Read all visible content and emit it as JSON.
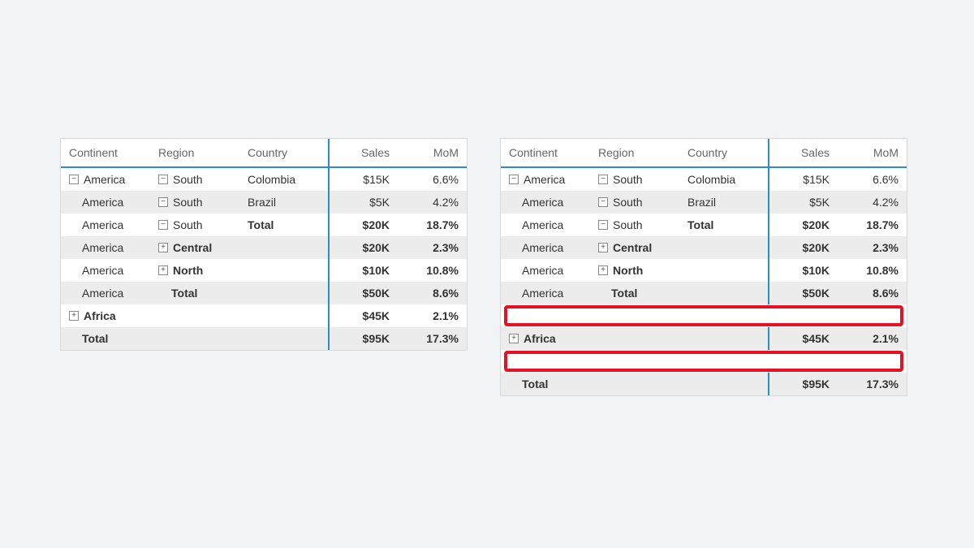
{
  "headers": {
    "continent": "Continent",
    "region": "Region",
    "country": "Country",
    "sales": "Sales",
    "mom": "MoM"
  },
  "glyph": {
    "plus": "+",
    "minus": "−"
  },
  "left": {
    "rows": [
      {
        "t": "data",
        "shade": false,
        "c": {
          "i": "minus",
          "txt": "America"
        },
        "r": {
          "i": "minus",
          "txt": "South"
        },
        "k": "Colombia",
        "kb": false,
        "s": "$15K",
        "m": "6.6%",
        "b": false
      },
      {
        "t": "data",
        "shade": true,
        "c": {
          "i": null,
          "txt": "America"
        },
        "r": {
          "i": "minus",
          "txt": "South"
        },
        "k": "Brazil",
        "kb": false,
        "s": "$5K",
        "m": "4.2%",
        "b": false
      },
      {
        "t": "data",
        "shade": false,
        "c": {
          "i": null,
          "txt": "America"
        },
        "r": {
          "i": "minus",
          "txt": "South"
        },
        "k": "Total",
        "kb": true,
        "s": "$20K",
        "m": "18.7%",
        "b": true
      },
      {
        "t": "data",
        "shade": true,
        "c": {
          "i": null,
          "txt": "America"
        },
        "r": {
          "i": "plus",
          "txt": "Central",
          "b": true
        },
        "k": "",
        "kb": false,
        "s": "$20K",
        "m": "2.3%",
        "b": true
      },
      {
        "t": "data",
        "shade": false,
        "c": {
          "i": null,
          "txt": "America"
        },
        "r": {
          "i": "plus",
          "txt": "North",
          "b": true
        },
        "k": "",
        "kb": false,
        "s": "$10K",
        "m": "10.8%",
        "b": true
      },
      {
        "t": "data",
        "shade": true,
        "c": {
          "i": null,
          "txt": "America"
        },
        "r": {
          "i": null,
          "txt": "Total",
          "b": true
        },
        "k": "",
        "kb": false,
        "s": "$50K",
        "m": "8.6%",
        "b": true
      },
      {
        "t": "data",
        "shade": false,
        "c": {
          "i": "plus",
          "txt": "Africa",
          "b": true
        },
        "r": {
          "i": null,
          "txt": ""
        },
        "k": "",
        "kb": false,
        "s": "$45K",
        "m": "2.1%",
        "b": true
      },
      {
        "t": "data",
        "shade": true,
        "c": {
          "i": null,
          "txt": "Total",
          "b": true
        },
        "r": {
          "i": null,
          "txt": ""
        },
        "k": "",
        "kb": false,
        "s": "$95K",
        "m": "17.3%",
        "b": true
      }
    ]
  },
  "right": {
    "rows": [
      {
        "t": "data",
        "shade": false,
        "c": {
          "i": "minus",
          "txt": "America"
        },
        "r": {
          "i": "minus",
          "txt": "South"
        },
        "k": "Colombia",
        "kb": false,
        "s": "$15K",
        "m": "6.6%",
        "b": false
      },
      {
        "t": "data",
        "shade": true,
        "c": {
          "i": null,
          "txt": "America"
        },
        "r": {
          "i": "minus",
          "txt": "South"
        },
        "k": "Brazil",
        "kb": false,
        "s": "$5K",
        "m": "4.2%",
        "b": false
      },
      {
        "t": "data",
        "shade": false,
        "c": {
          "i": null,
          "txt": "America"
        },
        "r": {
          "i": "minus",
          "txt": "South"
        },
        "k": "Total",
        "kb": true,
        "s": "$20K",
        "m": "18.7%",
        "b": true
      },
      {
        "t": "data",
        "shade": true,
        "c": {
          "i": null,
          "txt": "America"
        },
        "r": {
          "i": "plus",
          "txt": "Central",
          "b": true
        },
        "k": "",
        "kb": false,
        "s": "$20K",
        "m": "2.3%",
        "b": true
      },
      {
        "t": "data",
        "shade": false,
        "c": {
          "i": null,
          "txt": "America"
        },
        "r": {
          "i": "plus",
          "txt": "North",
          "b": true
        },
        "k": "",
        "kb": false,
        "s": "$10K",
        "m": "10.8%",
        "b": true
      },
      {
        "t": "data",
        "shade": true,
        "c": {
          "i": null,
          "txt": "America"
        },
        "r": {
          "i": null,
          "txt": "Total",
          "b": true
        },
        "k": "",
        "kb": false,
        "s": "$50K",
        "m": "8.6%",
        "b": true
      },
      {
        "t": "highlight"
      },
      {
        "t": "data",
        "shade": true,
        "c": {
          "i": "plus",
          "txt": "Africa",
          "b": true
        },
        "r": {
          "i": null,
          "txt": ""
        },
        "k": "",
        "kb": false,
        "s": "$45K",
        "m": "2.1%",
        "b": true
      },
      {
        "t": "highlight"
      },
      {
        "t": "data",
        "shade": true,
        "c": {
          "i": null,
          "txt": "Total",
          "b": true
        },
        "r": {
          "i": null,
          "txt": ""
        },
        "k": "",
        "kb": false,
        "s": "$95K",
        "m": "17.3%",
        "b": true
      }
    ]
  },
  "chart_data": {
    "type": "table",
    "columns": [
      "Continent",
      "Region",
      "Country",
      "Sales",
      "MoM"
    ],
    "rows": [
      [
        "America",
        "South",
        "Colombia",
        "$15K",
        "6.6%"
      ],
      [
        "America",
        "South",
        "Brazil",
        "$5K",
        "4.2%"
      ],
      [
        "America",
        "South",
        "Total",
        "$20K",
        "18.7%"
      ],
      [
        "America",
        "Central",
        "",
        "$20K",
        "2.3%"
      ],
      [
        "America",
        "North",
        "",
        "$10K",
        "10.8%"
      ],
      [
        "America",
        "Total",
        "",
        "$50K",
        "8.6%"
      ],
      [
        "Africa",
        "",
        "",
        "$45K",
        "2.1%"
      ],
      [
        "Total",
        "",
        "",
        "$95K",
        "17.3%"
      ]
    ]
  }
}
